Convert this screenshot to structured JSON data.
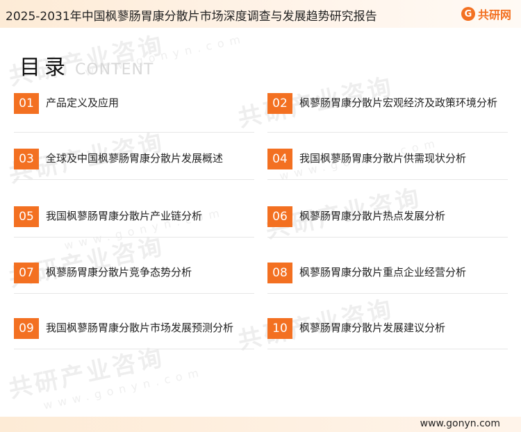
{
  "header": {
    "title": "2025-2031年中国枫蓼肠胃康分散片市场深度调查与发展趋势研究报告"
  },
  "logo": {
    "mark": "G",
    "text": "共研网"
  },
  "watermark": {
    "text": "共研产业咨询",
    "url": "www.gonyn.com"
  },
  "heading": {
    "title": "目录",
    "subtitle": "CONTENT"
  },
  "items": [
    {
      "num": "01",
      "label": "产品定义及应用"
    },
    {
      "num": "02",
      "label": "枫蓼肠胃康分散片宏观经济及政策环境分析"
    },
    {
      "num": "03",
      "label": "全球及中国枫蓼肠胃康分散片发展概述"
    },
    {
      "num": "04",
      "label": "我国枫蓼肠胃康分散片供需现状分析"
    },
    {
      "num": "05",
      "label": "我国枫蓼肠胃康分散片产业链分析"
    },
    {
      "num": "06",
      "label": "枫蓼肠胃康分散片热点发展分析"
    },
    {
      "num": "07",
      "label": "枫蓼肠胃康分散片竞争态势分析"
    },
    {
      "num": "08",
      "label": "枫蓼肠胃康分散片重点企业经营分析"
    },
    {
      "num": "09",
      "label": "我国枫蓼肠胃康分散片市场发展预测分析"
    },
    {
      "num": "10",
      "label": "枫蓼肠胃康分散片发展建议分析"
    }
  ],
  "footer": {
    "url": "www.gonyn.com"
  }
}
